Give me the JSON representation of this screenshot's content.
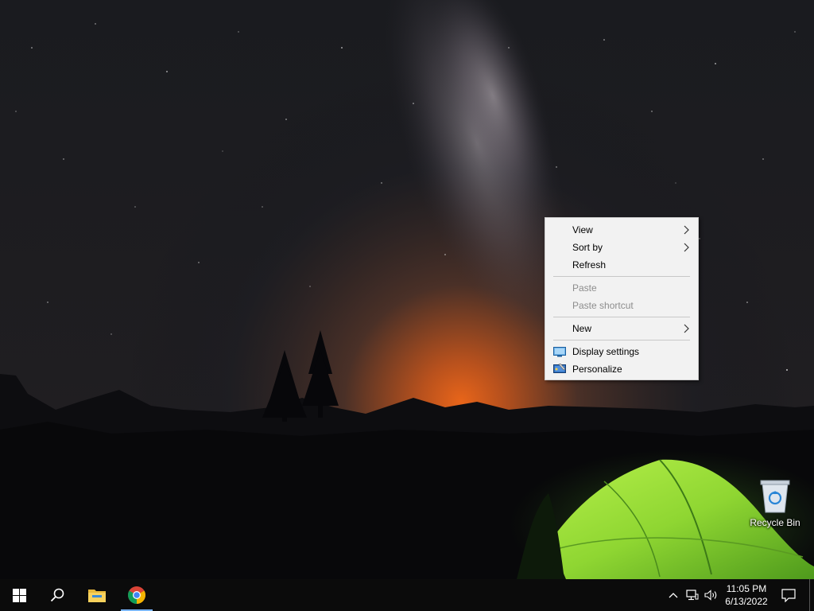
{
  "desktop": {
    "icons": [
      {
        "label": "Recycle Bin"
      }
    ]
  },
  "context_menu": {
    "items": [
      {
        "label": "View",
        "submenu": true,
        "enabled": true
      },
      {
        "label": "Sort by",
        "submenu": true,
        "enabled": true
      },
      {
        "label": "Refresh",
        "submenu": false,
        "enabled": true
      },
      {
        "label": "Paste",
        "submenu": false,
        "enabled": false
      },
      {
        "label": "Paste shortcut",
        "submenu": false,
        "enabled": false
      },
      {
        "label": "New",
        "submenu": true,
        "enabled": true
      },
      {
        "label": "Display settings",
        "icon": "display-icon",
        "enabled": true
      },
      {
        "label": "Personalize",
        "icon": "personalize-icon",
        "enabled": true
      }
    ]
  },
  "taskbar": {
    "pinned": [
      {
        "name": "start",
        "icon": "windows-logo-icon"
      },
      {
        "name": "search",
        "icon": "search-icon"
      },
      {
        "name": "file-explorer",
        "icon": "folder-icon"
      },
      {
        "name": "chrome",
        "icon": "chrome-icon",
        "active": true
      }
    ],
    "tray": {
      "time": "11:05 PM",
      "date": "6/13/2022"
    }
  },
  "colors": {
    "accent_active": "#7ab5ff",
    "taskbar_bg": "#0b0b0b",
    "menu_bg": "#f2f2f2"
  }
}
